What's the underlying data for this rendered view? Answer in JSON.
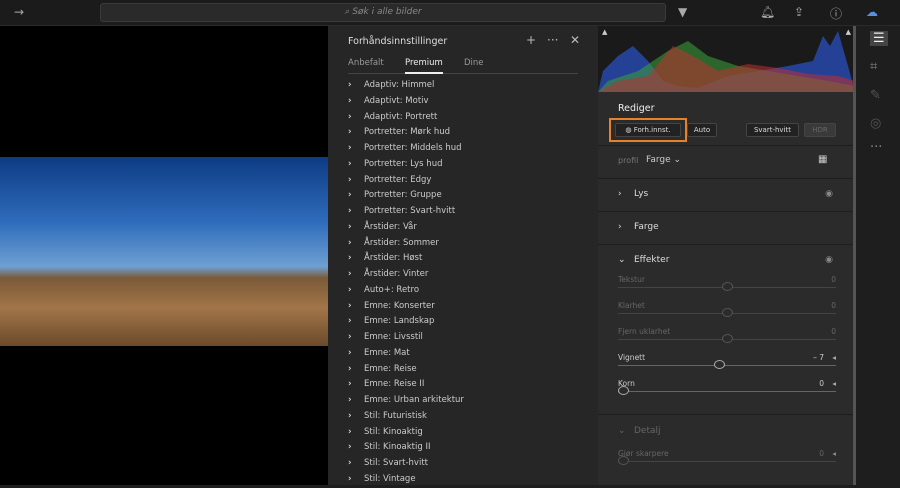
{
  "topbar": {
    "search_placeholder": "Søk i alle bilder"
  },
  "presets": {
    "title": "Forhåndsinnstillinger",
    "tabs": [
      "Anbefalt",
      "Premium",
      "Dine"
    ],
    "active_tab": "Premium",
    "items": [
      "Adaptiv: Himmel",
      "Adaptivt: Motiv",
      "Adaptivt: Portrett",
      "Portretter: Mørk hud",
      "Portretter: Middels hud",
      "Portretter: Lys hud",
      "Portretter: Edgy",
      "Portretter: Gruppe",
      "Portretter: Svart-hvitt",
      "Årstider: Vår",
      "Årstider: Sommer",
      "Årstider: Høst",
      "Årstider: Vinter",
      "Auto+: Retro",
      "Emne: Konserter",
      "Emne: Landskap",
      "Emne: Livsstil",
      "Emne: Mat",
      "Emne: Reise",
      "Emne: Reise II",
      "Emne: Urban arkitektur",
      "Stil: Futuristisk",
      "Stil: Kinoaktig",
      "Stil: Kinoaktig II",
      "Stil: Svart-hvitt",
      "Stil: Vintage"
    ]
  },
  "edit": {
    "title": "Rediger",
    "buttons": {
      "presets": "Forh.innst.",
      "auto": "Auto",
      "bw": "Svart-hvitt",
      "hdr": "HDR"
    },
    "profile_label": "profil",
    "profile_value": "Farge",
    "sections": {
      "light": "Lys",
      "color": "Farge",
      "effects": "Effekter",
      "detail": "Detalj"
    },
    "sliders": [
      {
        "label": "Tekstur",
        "value": "0",
        "pos": 0.5,
        "active": false
      },
      {
        "label": "Klarhet",
        "value": "0",
        "pos": 0.5,
        "active": false
      },
      {
        "label": "Fjern uklarhet",
        "value": "0",
        "pos": 0.5,
        "active": false
      },
      {
        "label": "Vignett",
        "value": "– 7",
        "pos": 0.465,
        "active": true
      },
      {
        "label": "Korn",
        "value": "0",
        "pos": 0,
        "active": true
      }
    ],
    "detail_slider": {
      "label": "Gjør skarpere",
      "value": "0",
      "pos": 0
    }
  },
  "colors": {
    "accent": "#e8822a"
  }
}
